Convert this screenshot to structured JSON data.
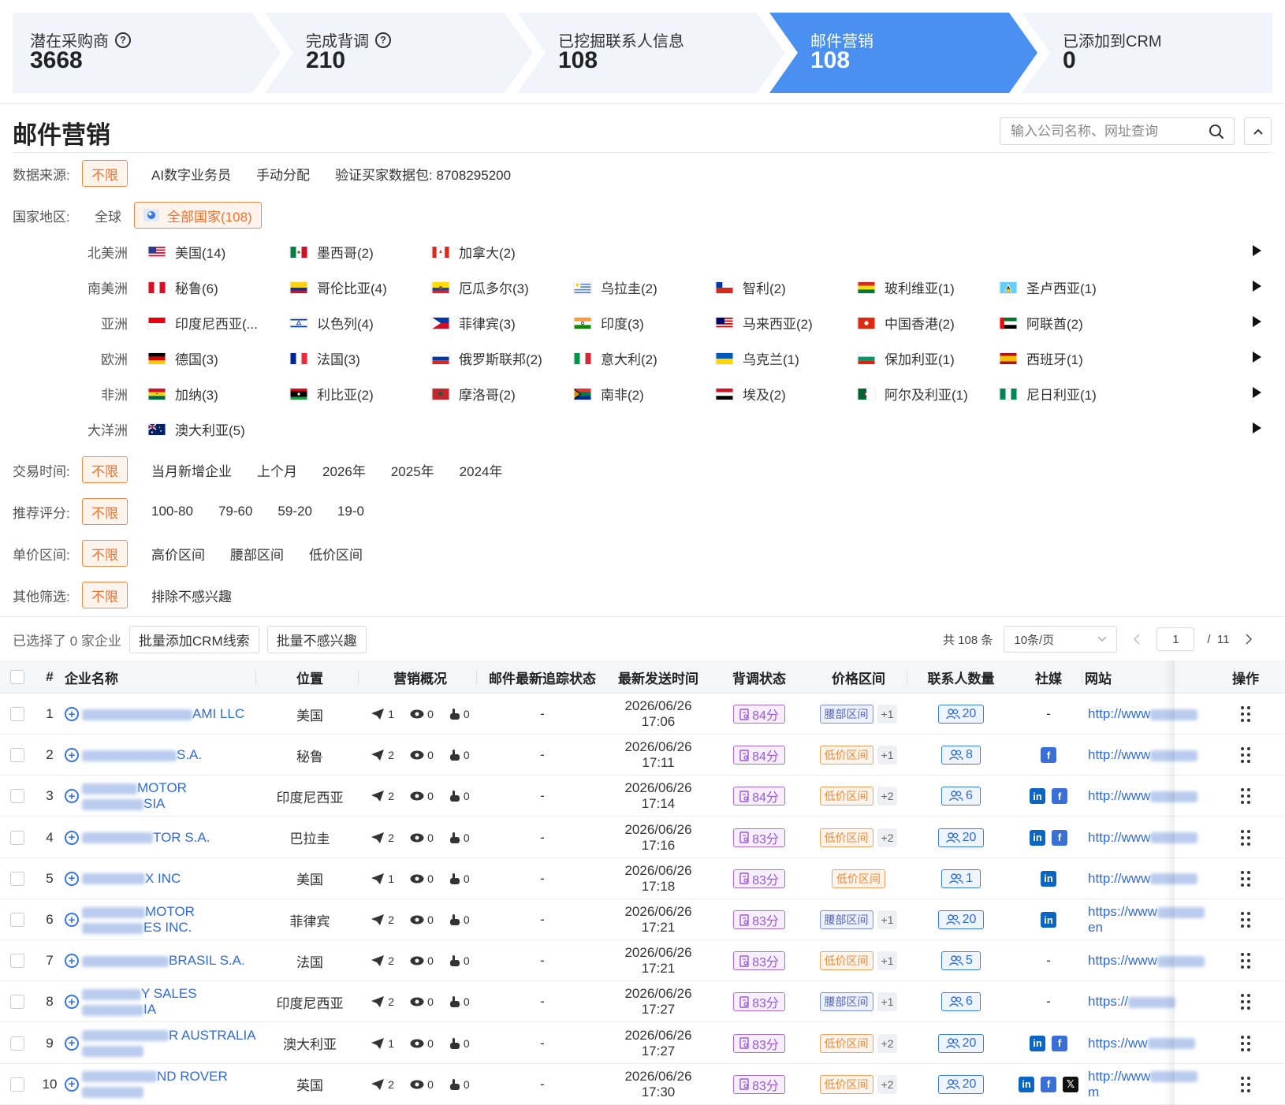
{
  "funnel": [
    {
      "label": "潜在采购商",
      "value": "3668",
      "help": true
    },
    {
      "label": "完成背调",
      "value": "210",
      "help": true
    },
    {
      "label": "已挖掘联系人信息",
      "value": "108",
      "help": false
    },
    {
      "label": "邮件营销",
      "value": "108",
      "help": false,
      "active": true
    },
    {
      "label": "已添加到CRM",
      "value": "0",
      "help": false
    }
  ],
  "header": {
    "title": "邮件营销",
    "search_placeholder": "输入公司名称、网址查询"
  },
  "filters": {
    "source": {
      "label": "数据来源:",
      "selected": "不限",
      "options": [
        "AI数字业务员",
        "手动分配",
        "验证买家数据包: 8708295200"
      ]
    },
    "region": {
      "label": "国家地区:",
      "global": "全球",
      "selected": "全部国家(108)"
    },
    "trade_time": {
      "label": "交易时间:",
      "selected": "不限",
      "options": [
        "当月新增企业",
        "上个月",
        "2026年",
        "2025年",
        "2024年"
      ]
    },
    "score": {
      "label": "推荐评分:",
      "selected": "不限",
      "options": [
        "100-80",
        "79-60",
        "59-20",
        "19-0"
      ]
    },
    "price": {
      "label": "单价区间:",
      "selected": "不限",
      "options": [
        "高价区间",
        "腰部区间",
        "低价区间"
      ]
    },
    "other": {
      "label": "其他筛选:",
      "selected": "不限",
      "options": [
        "排除不感兴趣"
      ]
    }
  },
  "regions": [
    {
      "name": "北美洲",
      "countries": [
        {
          "label": "美国(14)",
          "flag": "us"
        },
        {
          "label": "墨西哥(2)",
          "flag": "mx"
        },
        {
          "label": "加拿大(2)",
          "flag": "ca"
        }
      ]
    },
    {
      "name": "南美洲",
      "countries": [
        {
          "label": "秘鲁(6)",
          "flag": "pe"
        },
        {
          "label": "哥伦比亚(4)",
          "flag": "co"
        },
        {
          "label": "厄瓜多尔(3)",
          "flag": "ec"
        },
        {
          "label": "乌拉圭(2)",
          "flag": "uy"
        },
        {
          "label": "智利(2)",
          "flag": "cl"
        },
        {
          "label": "玻利维亚(1)",
          "flag": "bo"
        },
        {
          "label": "圣卢西亚(1)",
          "flag": "lc"
        }
      ]
    },
    {
      "name": "亚洲",
      "countries": [
        {
          "label": "印度尼西亚(...",
          "flag": "id"
        },
        {
          "label": "以色列(4)",
          "flag": "il"
        },
        {
          "label": "菲律宾(3)",
          "flag": "ph"
        },
        {
          "label": "印度(3)",
          "flag": "in"
        },
        {
          "label": "马来西亚(2)",
          "flag": "my"
        },
        {
          "label": "中国香港(2)",
          "flag": "hk"
        },
        {
          "label": "阿联酋(2)",
          "flag": "ae"
        }
      ]
    },
    {
      "name": "欧洲",
      "countries": [
        {
          "label": "德国(3)",
          "flag": "de"
        },
        {
          "label": "法国(3)",
          "flag": "fr"
        },
        {
          "label": "俄罗斯联邦(2)",
          "flag": "ru"
        },
        {
          "label": "意大利(2)",
          "flag": "it"
        },
        {
          "label": "乌克兰(1)",
          "flag": "ua"
        },
        {
          "label": "保加利亚(1)",
          "flag": "bg"
        },
        {
          "label": "西班牙(1)",
          "flag": "es"
        }
      ]
    },
    {
      "name": "非洲",
      "countries": [
        {
          "label": "加纳(3)",
          "flag": "gh"
        },
        {
          "label": "利比亚(2)",
          "flag": "ly"
        },
        {
          "label": "摩洛哥(2)",
          "flag": "ma"
        },
        {
          "label": "南非(2)",
          "flag": "za"
        },
        {
          "label": "埃及(2)",
          "flag": "eg"
        },
        {
          "label": "阿尔及利亚(1)",
          "flag": "dz"
        },
        {
          "label": "尼日利亚(1)",
          "flag": "ng"
        }
      ]
    },
    {
      "name": "大洋洲",
      "countries": [
        {
          "label": "澳大利亚(5)",
          "flag": "au"
        }
      ]
    }
  ],
  "bulk": {
    "selected_text": "已选择了 0 家企业",
    "add_crm": "批量添加CRM线索",
    "not_interested": "批量不感兴趣"
  },
  "pagination": {
    "total": "共 108 条",
    "page_size": "10条/页",
    "current": "1",
    "of_total": "/  11"
  },
  "table": {
    "headers": [
      "#",
      "企业名称",
      "位置",
      "营销概况",
      "邮件最新追踪状态",
      "最新发送时间",
      "背调状态",
      "价格区间",
      "联系人数量",
      "社媒",
      "网站",
      "操作"
    ],
    "rows": [
      {
        "idx": "1",
        "name": [
          "AMI LLC"
        ],
        "loc": "美国",
        "sent": "1",
        "open": "0",
        "click": "0",
        "status": "-",
        "date": "2026/06/26",
        "time": "17:06",
        "score": "84分",
        "price": "腰部区间",
        "ptype": "mid",
        "more": "+1",
        "contacts": "20",
        "social": [],
        "web": [
          "http://www"
        ]
      },
      {
        "idx": "2",
        "name": [
          "S.A."
        ],
        "loc": "秘鲁",
        "sent": "2",
        "open": "0",
        "click": "0",
        "status": "-",
        "date": "2026/06/26",
        "time": "17:11",
        "score": "84分",
        "price": "低价区间",
        "ptype": "low",
        "more": "+1",
        "contacts": "8",
        "social": [
          "fb"
        ],
        "web": [
          "http://www"
        ]
      },
      {
        "idx": "3",
        "name": [
          "MOTOR",
          "SIA"
        ],
        "loc": "印度尼西亚",
        "sent": "2",
        "open": "0",
        "click": "0",
        "status": "-",
        "date": "2026/06/26",
        "time": "17:14",
        "score": "84分",
        "price": "低价区间",
        "ptype": "low",
        "more": "+2",
        "contacts": "6",
        "social": [
          "li",
          "fb"
        ],
        "web": [
          "http://www"
        ]
      },
      {
        "idx": "4",
        "name": [
          "TOR S.A."
        ],
        "loc": "巴拉圭",
        "sent": "2",
        "open": "0",
        "click": "0",
        "status": "-",
        "date": "2026/06/26",
        "time": "17:16",
        "score": "83分",
        "price": "低价区间",
        "ptype": "low",
        "more": "+2",
        "contacts": "20",
        "social": [
          "li",
          "fb"
        ],
        "web": [
          "http://www"
        ]
      },
      {
        "idx": "5",
        "name": [
          "X INC"
        ],
        "loc": "美国",
        "sent": "1",
        "open": "0",
        "click": "0",
        "status": "-",
        "date": "2026/06/26",
        "time": "17:18",
        "score": "83分",
        "price": "低价区间",
        "ptype": "low",
        "more": "",
        "contacts": "1",
        "social": [
          "li"
        ],
        "web": [
          "http://www"
        ]
      },
      {
        "idx": "6",
        "name": [
          "MOTOR",
          "ES INC."
        ],
        "loc": "菲律宾",
        "sent": "2",
        "open": "0",
        "click": "0",
        "status": "-",
        "date": "2026/06/26",
        "time": "17:21",
        "score": "83分",
        "price": "腰部区间",
        "ptype": "mid",
        "more": "+1",
        "contacts": "20",
        "social": [
          "li"
        ],
        "web": [
          "https://www",
          "en"
        ]
      },
      {
        "idx": "7",
        "name": [
          "BRASIL S.A."
        ],
        "loc": "法国",
        "sent": "2",
        "open": "0",
        "click": "0",
        "status": "-",
        "date": "2026/06/26",
        "time": "17:21",
        "score": "83分",
        "price": "低价区间",
        "ptype": "low",
        "more": "+1",
        "contacts": "5",
        "social": [],
        "web": [
          "https://www"
        ]
      },
      {
        "idx": "8",
        "name": [
          "Y SALES",
          "IA"
        ],
        "loc": "印度尼西亚",
        "sent": "2",
        "open": "0",
        "click": "0",
        "status": "-",
        "date": "2026/06/26",
        "time": "17:27",
        "score": "83分",
        "price": "腰部区间",
        "ptype": "mid",
        "more": "+1",
        "contacts": "6",
        "social": [],
        "web": [
          "https://"
        ]
      },
      {
        "idx": "9",
        "name": [
          "R AUSTRALIA",
          ""
        ],
        "loc": "澳大利亚",
        "sent": "1",
        "open": "0",
        "click": "0",
        "status": "-",
        "date": "2026/06/26",
        "time": "17:27",
        "score": "83分",
        "price": "低价区间",
        "ptype": "low",
        "more": "+2",
        "contacts": "20",
        "social": [
          "li",
          "fb"
        ],
        "web": [
          "https://ww"
        ]
      },
      {
        "idx": "10",
        "name": [
          "ND ROVER",
          ""
        ],
        "loc": "英国",
        "sent": "2",
        "open": "0",
        "click": "0",
        "status": "-",
        "date": "2026/06/26",
        "time": "17:30",
        "score": "83分",
        "price": "低价区间",
        "ptype": "low",
        "more": "+2",
        "contacts": "20",
        "social": [
          "li",
          "fb",
          "x"
        ],
        "web": [
          "http://www",
          "m"
        ]
      }
    ]
  },
  "colors": {
    "accent": "#4a90f0",
    "orange": "#f07030",
    "link": "#2f6bd8",
    "purple": "#9a58d6"
  }
}
